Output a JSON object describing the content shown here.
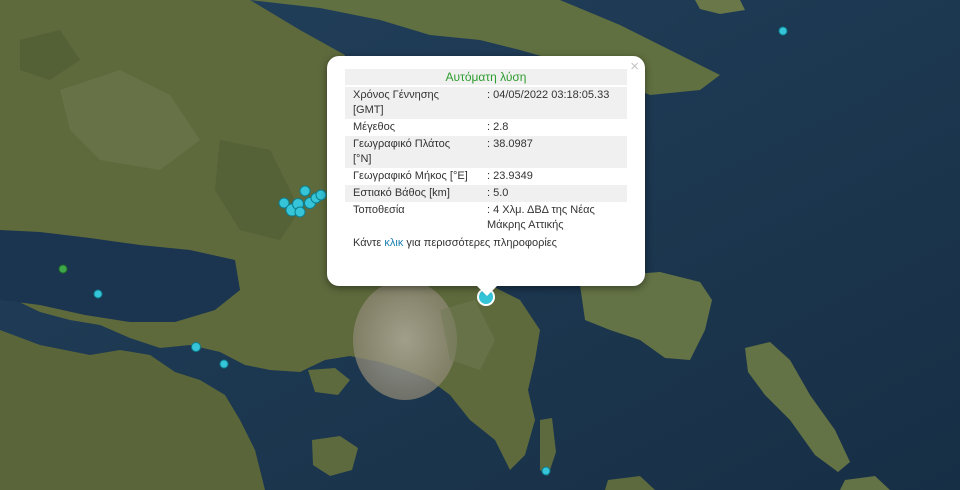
{
  "popup": {
    "title": "Αυτόματη λύση",
    "close_glyph": "×",
    "rows": [
      {
        "label": "Χρόνος Γέννησης [GMT]",
        "value": ": 04/05/2022 03:18:05.33"
      },
      {
        "label": "Μέγεθος",
        "value": ": 2.8"
      },
      {
        "label": "Γεωγραφικό Πλάτος [°N]",
        "value": ": 38.0987"
      },
      {
        "label": "Γεωγραφικό Μήκος [°E]",
        "value": ": 23.9349"
      },
      {
        "label": "Εστιακό Βάθος [km]",
        "value": ": 5.0"
      },
      {
        "label": "Τοποθεσία",
        "value": ": 4 Χλμ. ΔΒΔ της Νέας Μάκρης Αττικής"
      }
    ],
    "footer": {
      "prefix": "Κάντε ",
      "link": "κλικ",
      "suffix": " για περισσότερες πληροφορίες"
    }
  },
  "colors": {
    "quake_marker": "#35c4d8",
    "quake_marker_older": "#3fa64a",
    "popup_title": "#2e9d2e",
    "link": "#1a7fae",
    "sea": "#1d3a52",
    "land": "#5e6a3c"
  },
  "icons": {
    "close": "close-icon",
    "quake": "earthquake-marker-icon"
  }
}
